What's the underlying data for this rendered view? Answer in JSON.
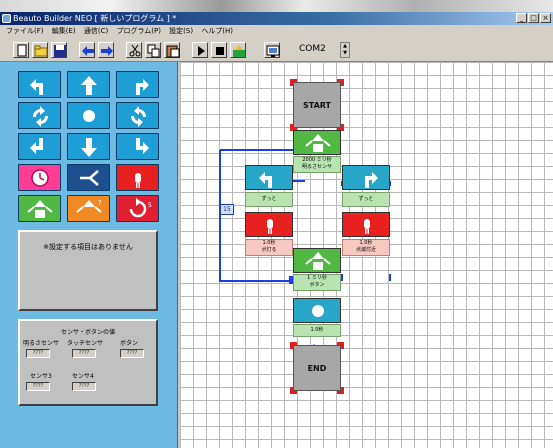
{
  "window": {
    "title": "Beauto Builder NEO [ 新しいプログラム ] *"
  },
  "menu": [
    "ファイル(F)",
    "編集(E)",
    "通信(C)",
    "プログラム(P)",
    "設定(S)",
    "ヘルプ(H)"
  ],
  "toolbar": {
    "buttons": [
      "new-icon",
      "open-icon",
      "save-icon",
      "undo-icon",
      "redo-icon",
      "cut-icon",
      "copy-icon",
      "paste-icon",
      "run-icon",
      "stop-icon",
      "transfer-icon",
      "settings-icon"
    ],
    "port_label": "COM2"
  },
  "palette": {
    "description": "※設定する項目はありません",
    "sensor_title": "センサ・ボタンの値",
    "sensor_labels": [
      "明るさセンサ",
      "タッチセンサ",
      "ボタン",
      "センサ3",
      "センサ4"
    ],
    "sensor_values": [
      "????",
      "????",
      "????",
      "????",
      "????"
    ]
  },
  "program": {
    "start_label": "START",
    "end_label": "END",
    "branch1_label": "2000 ミリ秒\n明るさセンサ",
    "left_wait_label": "ずっと",
    "right_wait_label": "ずっと",
    "left_time_label": "1.0秒\nボ灯る",
    "right_time_label": "1.0秒\n点滅付近",
    "branch2_label": "1 ミリ秒\nボタン",
    "final_wait_label": "1.0秒",
    "loop_counter": "15"
  },
  "colors": {
    "palette_bg": "#6dbbe3",
    "block_blue": "#1e9ed6",
    "block_red": "#e82020",
    "block_green": "#52b844",
    "flow_arrow": "#1c3fd6",
    "canvas_grid": "#b9b9b9"
  }
}
